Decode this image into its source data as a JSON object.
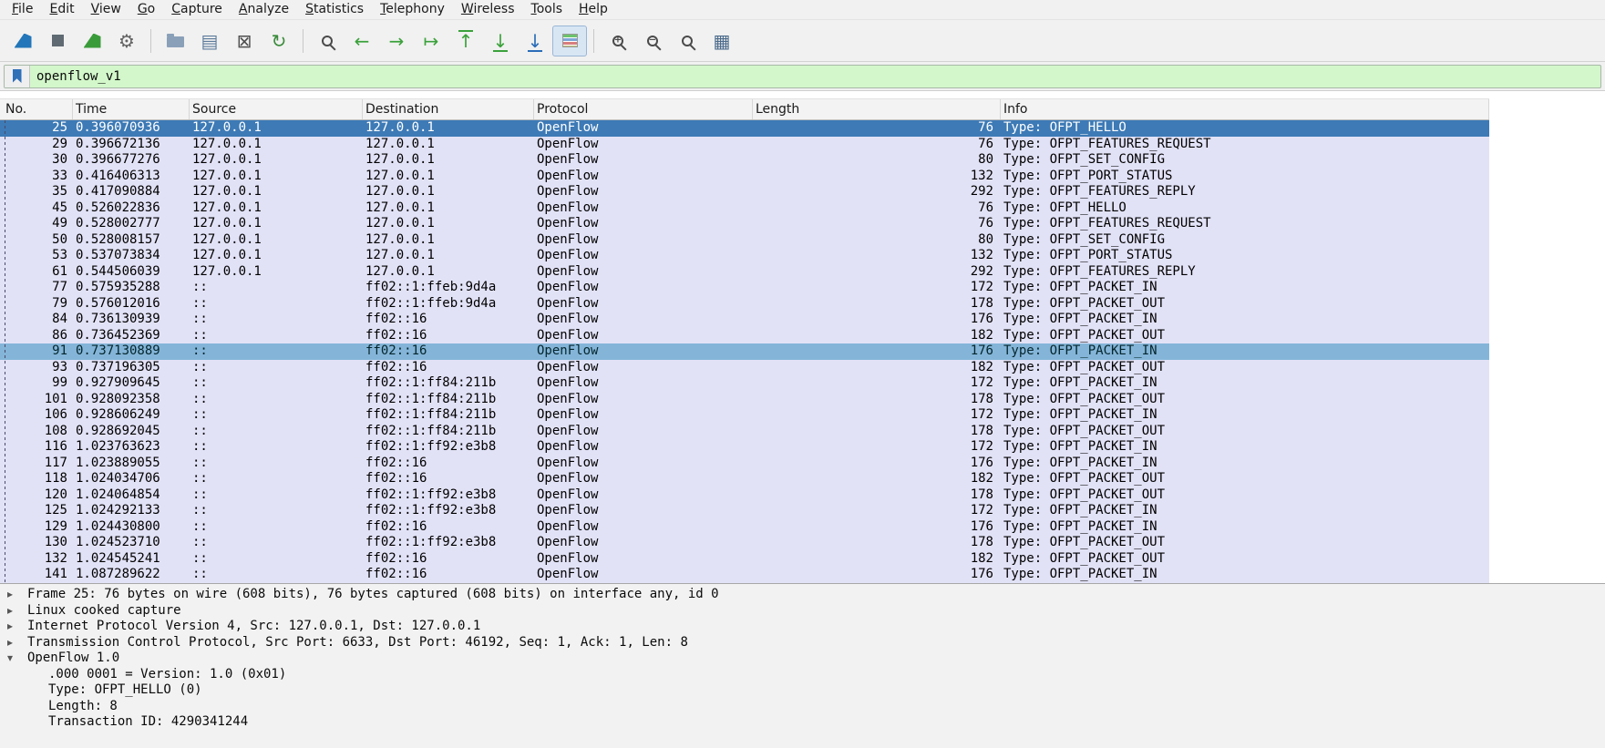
{
  "menu": {
    "items": [
      "File",
      "Edit",
      "View",
      "Go",
      "Capture",
      "Analyze",
      "Statistics",
      "Telephony",
      "Wireless",
      "Tools",
      "Help"
    ]
  },
  "toolbar": {
    "buttons": [
      {
        "name": "start-capture",
        "icon": "fin",
        "color": "#2276b9"
      },
      {
        "name": "stop-capture",
        "icon": "square",
        "color": "#5f6a72"
      },
      {
        "name": "restart-capture",
        "icon": "fin",
        "color": "#3a9b3a"
      },
      {
        "name": "capture-options",
        "icon": "glyph",
        "glyph": "⚙",
        "color": "#636363"
      },
      {
        "type": "separator"
      },
      {
        "name": "open-capture-file",
        "icon": "folder",
        "color": "#8aa0b8"
      },
      {
        "name": "save-capture-file",
        "icon": "glyph",
        "glyph": "▤",
        "color": "#5b7a9a"
      },
      {
        "name": "close-capture-file",
        "icon": "glyph",
        "glyph": "⊠",
        "color": "#4f4f4f"
      },
      {
        "name": "reload-capture-file",
        "icon": "glyph",
        "glyph": "↻",
        "color": "#3a8a3a"
      },
      {
        "type": "separator"
      },
      {
        "name": "find-packet",
        "icon": "mag",
        "color": "#4a4a4a"
      },
      {
        "name": "go-back",
        "icon": "glyph",
        "glyph": "←",
        "color": "#3aa13a"
      },
      {
        "name": "go-forward",
        "icon": "glyph",
        "glyph": "→",
        "color": "#3aa13a"
      },
      {
        "name": "go-to-packet",
        "icon": "glyph",
        "glyph": "↦",
        "color": "#3aa13a"
      },
      {
        "name": "go-first-packet",
        "icon": "glyph",
        "glyph": "↑",
        "bar": "top",
        "color": "#3aa13a"
      },
      {
        "name": "go-last-packet",
        "icon": "glyph",
        "glyph": "↓",
        "bar": "bottom",
        "color": "#3aa13a"
      },
      {
        "name": "auto-scroll",
        "icon": "glyph",
        "glyph": "↓",
        "bar": "bottom",
        "color": "#2a6db8"
      },
      {
        "name": "colorize-packets",
        "icon": "colorize",
        "active": true
      },
      {
        "type": "separator"
      },
      {
        "name": "zoom-in",
        "icon": "mag",
        "sign": "+",
        "color": "#4a4a4a"
      },
      {
        "name": "zoom-out",
        "icon": "mag",
        "sign": "−",
        "color": "#4a4a4a"
      },
      {
        "name": "zoom-original",
        "icon": "mag",
        "sign": "",
        "color": "#4a4a4a"
      },
      {
        "name": "resize-columns",
        "icon": "glyph",
        "glyph": "▦",
        "color": "#4a6a8a"
      }
    ]
  },
  "filter": {
    "value": "openflow_v1"
  },
  "colors": {
    "row_bg": "#e2e2f7",
    "selected_row": "#3d7ab6",
    "highlighted_row": "#84b5d8",
    "filter_valid_bg": "#d3f7ca"
  },
  "packet_list": {
    "columns": [
      {
        "key": "no",
        "label": "No."
      },
      {
        "key": "time",
        "label": "Time"
      },
      {
        "key": "source",
        "label": "Source"
      },
      {
        "key": "destination",
        "label": "Destination"
      },
      {
        "key": "protocol",
        "label": "Protocol"
      },
      {
        "key": "length",
        "label": "Length"
      },
      {
        "key": "info",
        "label": "Info"
      }
    ],
    "rows": [
      {
        "no": "25",
        "time": "0.396070936",
        "source": "127.0.0.1",
        "destination": "127.0.0.1",
        "protocol": "OpenFlow",
        "length": "76",
        "info": "Type: OFPT_HELLO",
        "state": "selected"
      },
      {
        "no": "29",
        "time": "0.396672136",
        "source": "127.0.0.1",
        "destination": "127.0.0.1",
        "protocol": "OpenFlow",
        "length": "76",
        "info": "Type: OFPT_FEATURES_REQUEST"
      },
      {
        "no": "30",
        "time": "0.396677276",
        "source": "127.0.0.1",
        "destination": "127.0.0.1",
        "protocol": "OpenFlow",
        "length": "80",
        "info": "Type: OFPT_SET_CONFIG"
      },
      {
        "no": "33",
        "time": "0.416406313",
        "source": "127.0.0.1",
        "destination": "127.0.0.1",
        "protocol": "OpenFlow",
        "length": "132",
        "info": "Type: OFPT_PORT_STATUS"
      },
      {
        "no": "35",
        "time": "0.417090884",
        "source": "127.0.0.1",
        "destination": "127.0.0.1",
        "protocol": "OpenFlow",
        "length": "292",
        "info": "Type: OFPT_FEATURES_REPLY"
      },
      {
        "no": "45",
        "time": "0.526022836",
        "source": "127.0.0.1",
        "destination": "127.0.0.1",
        "protocol": "OpenFlow",
        "length": "76",
        "info": "Type: OFPT_HELLO"
      },
      {
        "no": "49",
        "time": "0.528002777",
        "source": "127.0.0.1",
        "destination": "127.0.0.1",
        "protocol": "OpenFlow",
        "length": "76",
        "info": "Type: OFPT_FEATURES_REQUEST"
      },
      {
        "no": "50",
        "time": "0.528008157",
        "source": "127.0.0.1",
        "destination": "127.0.0.1",
        "protocol": "OpenFlow",
        "length": "80",
        "info": "Type: OFPT_SET_CONFIG"
      },
      {
        "no": "53",
        "time": "0.537073834",
        "source": "127.0.0.1",
        "destination": "127.0.0.1",
        "protocol": "OpenFlow",
        "length": "132",
        "info": "Type: OFPT_PORT_STATUS"
      },
      {
        "no": "61",
        "time": "0.544506039",
        "source": "127.0.0.1",
        "destination": "127.0.0.1",
        "protocol": "OpenFlow",
        "length": "292",
        "info": "Type: OFPT_FEATURES_REPLY"
      },
      {
        "no": "77",
        "time": "0.575935288",
        "source": "::",
        "destination": "ff02::1:ffeb:9d4a",
        "protocol": "OpenFlow",
        "length": "172",
        "info": "Type: OFPT_PACKET_IN"
      },
      {
        "no": "79",
        "time": "0.576012016",
        "source": "::",
        "destination": "ff02::1:ffeb:9d4a",
        "protocol": "OpenFlow",
        "length": "178",
        "info": "Type: OFPT_PACKET_OUT"
      },
      {
        "no": "84",
        "time": "0.736130939",
        "source": "::",
        "destination": "ff02::16",
        "protocol": "OpenFlow",
        "length": "176",
        "info": "Type: OFPT_PACKET_IN"
      },
      {
        "no": "86",
        "time": "0.736452369",
        "source": "::",
        "destination": "ff02::16",
        "protocol": "OpenFlow",
        "length": "182",
        "info": "Type: OFPT_PACKET_OUT"
      },
      {
        "no": "91",
        "time": "0.737130889",
        "source": "::",
        "destination": "ff02::16",
        "protocol": "OpenFlow",
        "length": "176",
        "info": "Type: OFPT_PACKET_IN",
        "state": "highlighted"
      },
      {
        "no": "93",
        "time": "0.737196305",
        "source": "::",
        "destination": "ff02::16",
        "protocol": "OpenFlow",
        "length": "182",
        "info": "Type: OFPT_PACKET_OUT"
      },
      {
        "no": "99",
        "time": "0.927909645",
        "source": "::",
        "destination": "ff02::1:ff84:211b",
        "protocol": "OpenFlow",
        "length": "172",
        "info": "Type: OFPT_PACKET_IN"
      },
      {
        "no": "101",
        "time": "0.928092358",
        "source": "::",
        "destination": "ff02::1:ff84:211b",
        "protocol": "OpenFlow",
        "length": "178",
        "info": "Type: OFPT_PACKET_OUT"
      },
      {
        "no": "106",
        "time": "0.928606249",
        "source": "::",
        "destination": "ff02::1:ff84:211b",
        "protocol": "OpenFlow",
        "length": "172",
        "info": "Type: OFPT_PACKET_IN"
      },
      {
        "no": "108",
        "time": "0.928692045",
        "source": "::",
        "destination": "ff02::1:ff84:211b",
        "protocol": "OpenFlow",
        "length": "178",
        "info": "Type: OFPT_PACKET_OUT"
      },
      {
        "no": "116",
        "time": "1.023763623",
        "source": "::",
        "destination": "ff02::1:ff92:e3b8",
        "protocol": "OpenFlow",
        "length": "172",
        "info": "Type: OFPT_PACKET_IN"
      },
      {
        "no": "117",
        "time": "1.023889055",
        "source": "::",
        "destination": "ff02::16",
        "protocol": "OpenFlow",
        "length": "176",
        "info": "Type: OFPT_PACKET_IN"
      },
      {
        "no": "118",
        "time": "1.024034706",
        "source": "::",
        "destination": "ff02::16",
        "protocol": "OpenFlow",
        "length": "182",
        "info": "Type: OFPT_PACKET_OUT"
      },
      {
        "no": "120",
        "time": "1.024064854",
        "source": "::",
        "destination": "ff02::1:ff92:e3b8",
        "protocol": "OpenFlow",
        "length": "178",
        "info": "Type: OFPT_PACKET_OUT"
      },
      {
        "no": "125",
        "time": "1.024292133",
        "source": "::",
        "destination": "ff02::1:ff92:e3b8",
        "protocol": "OpenFlow",
        "length": "172",
        "info": "Type: OFPT_PACKET_IN"
      },
      {
        "no": "129",
        "time": "1.024430800",
        "source": "::",
        "destination": "ff02::16",
        "protocol": "OpenFlow",
        "length": "176",
        "info": "Type: OFPT_PACKET_IN"
      },
      {
        "no": "130",
        "time": "1.024523710",
        "source": "::",
        "destination": "ff02::1:ff92:e3b8",
        "protocol": "OpenFlow",
        "length": "178",
        "info": "Type: OFPT_PACKET_OUT"
      },
      {
        "no": "132",
        "time": "1.024545241",
        "source": "::",
        "destination": "ff02::16",
        "protocol": "OpenFlow",
        "length": "182",
        "info": "Type: OFPT_PACKET_OUT"
      },
      {
        "no": "141",
        "time": "1.087289622",
        "source": "::",
        "destination": "ff02::16",
        "protocol": "OpenFlow",
        "length": "176",
        "info": "Type: OFPT_PACKET_IN"
      }
    ]
  },
  "details": {
    "lines": [
      {
        "indent": 0,
        "expanded": false,
        "text": "Frame 25: 76 bytes on wire (608 bits), 76 bytes captured (608 bits) on interface any, id 0"
      },
      {
        "indent": 0,
        "expanded": false,
        "text": "Linux cooked capture"
      },
      {
        "indent": 0,
        "expanded": false,
        "text": "Internet Protocol Version 4, Src: 127.0.0.1, Dst: 127.0.0.1"
      },
      {
        "indent": 0,
        "expanded": false,
        "text": "Transmission Control Protocol, Src Port: 6633, Dst Port: 46192, Seq: 1, Ack: 1, Len: 8"
      },
      {
        "indent": 0,
        "expanded": true,
        "text": "OpenFlow 1.0"
      },
      {
        "indent": 1,
        "text": ".000 0001 = Version: 1.0 (0x01)"
      },
      {
        "indent": 1,
        "text": "Type: OFPT_HELLO (0)"
      },
      {
        "indent": 1,
        "text": "Length: 8"
      },
      {
        "indent": 1,
        "text": "Transaction ID: 4290341244"
      }
    ]
  }
}
